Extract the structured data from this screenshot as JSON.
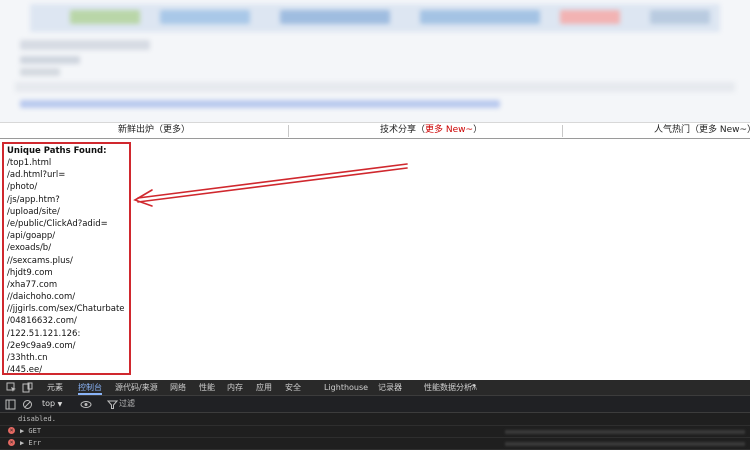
{
  "header": {
    "col1_label": "新鲜出炉（更多）",
    "col2_label": "技术分享（",
    "col2_more": "更多 New~",
    "col2_end": "）",
    "col3_label": "人气热门（更多 New~）"
  },
  "paths_panel": {
    "title": "Unique Paths Found:",
    "items": [
      "/top1.html",
      "/ad.html?url=",
      "/photo/",
      "/js/app.htm?",
      "/upload/site/",
      "/e/public/ClickAd?adid=",
      "/api/goapp/",
      "/exoads/b/",
      "//sexcams.plus/",
      "/hjdt9.com",
      "/xha77.com",
      "//daichoho.com/",
      "//jjgirls.com/sex/Chaturbate",
      "/04816632.com/",
      "/122.51.121.126:",
      "/2e9c9aa9.com/",
      "/33hth.cn",
      "/445.ee/"
    ]
  },
  "devtools": {
    "tabs": [
      "元素",
      "控制台",
      "源代码/来源",
      "网络",
      "性能",
      "内存",
      "应用",
      "安全",
      "Lighthouse",
      "记录器",
      "性能数据分析"
    ],
    "active_tab": "控制台",
    "context_select": "top",
    "filter_placeholder": "过滤",
    "console_lines": [
      "disabled.",
      "▶ GET",
      "▶ Err"
    ],
    "accent_color": "#8ab4f8",
    "error_color": "#e46962"
  },
  "annotation_color": "#d0282e"
}
